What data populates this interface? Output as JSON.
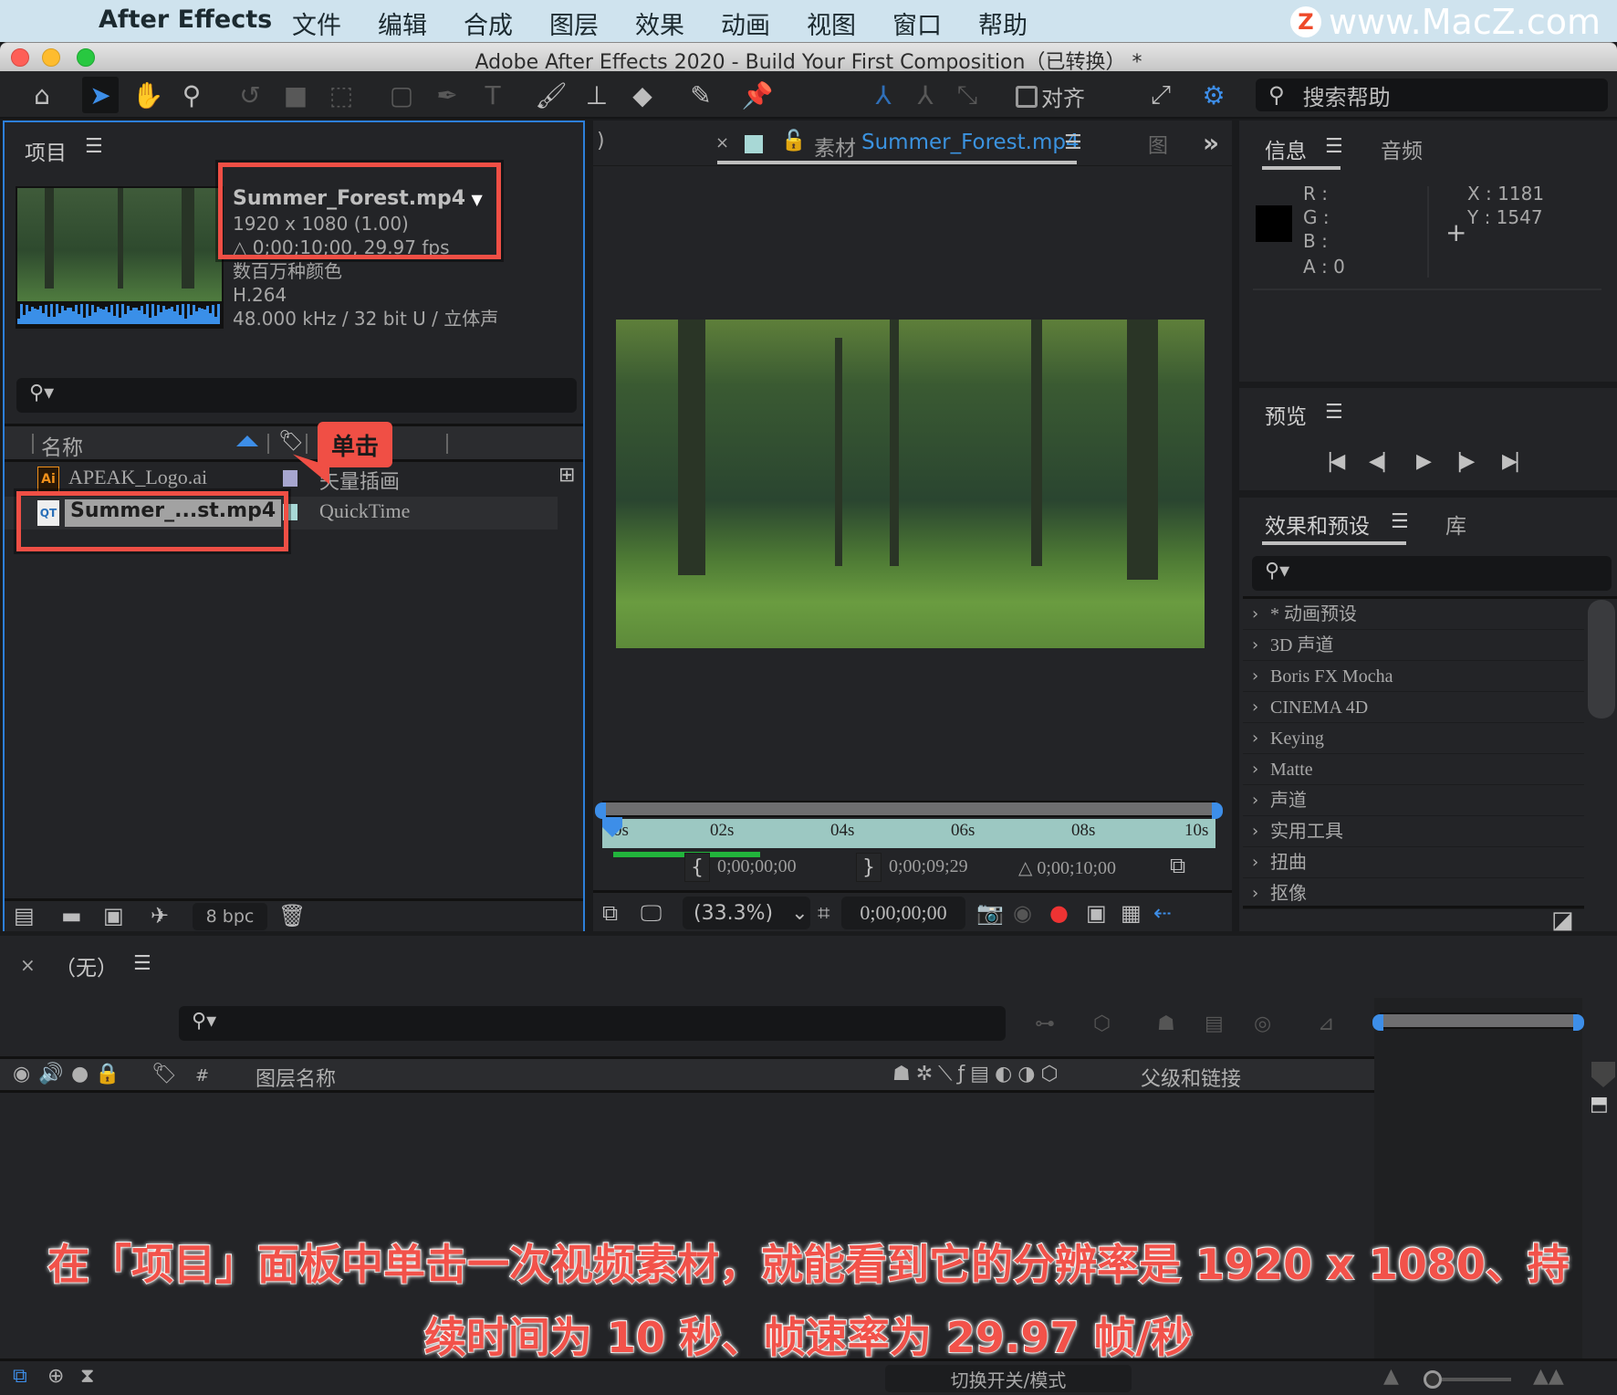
{
  "menubar": {
    "app_name": "After Effects",
    "items": [
      "文件",
      "编辑",
      "合成",
      "图层",
      "效果",
      "动画",
      "视图",
      "窗口",
      "帮助"
    ],
    "watermark": "www.MacZ.com",
    "watermark_logo": "Z"
  },
  "window": {
    "title": "Adobe After Effects 2020 - Build Your First Composition（已转换） *"
  },
  "toolbar": {
    "tools": [
      "home-icon",
      "selection-tool-icon",
      "hand-tool-icon",
      "zoom-tool-icon",
      "rotate-tool-icon",
      "camera-tool-icon",
      "pan-behind-tool-icon",
      "rectangle-tool-icon",
      "pen-tool-icon",
      "type-tool-icon",
      "brush-tool-icon",
      "clone-stamp-icon",
      "eraser-icon",
      "roto-brush-icon",
      "puppet-pin-icon"
    ],
    "snap_label": "对齐",
    "help_search_placeholder": "搜索帮助"
  },
  "project": {
    "title": "项目",
    "selected_item": {
      "name": "Summer_Forest.mp4",
      "dimensions": "1920 x 1080 (1.00)",
      "duration_fps": "△ 0;00;10;00, 29.97 fps",
      "colors": "数百万种颜色",
      "codec": "H.264",
      "audio": "48.000 kHz / 32 bit U / 立体声"
    },
    "search_placeholder": "",
    "columns": {
      "name": "名称",
      "type": ""
    },
    "items": [
      {
        "icon": "Ai",
        "name": "APEAK_Logo.ai",
        "label_color": "#a7a6cf",
        "type": "矢量插画",
        "selected": false
      },
      {
        "icon": "QT",
        "name": "Summer_...st.mp4",
        "label_color": "#a8d8d6",
        "type": "QuickTime",
        "selected": true
      }
    ],
    "callout": "单击",
    "bpc": "8 bpc"
  },
  "viewer": {
    "tab_prefix": "素材",
    "tab_name": "Summer_Forest.mp4",
    "tab_swatch_color": "#a8d8d6",
    "ruler_ticks": [
      "0s",
      "02s",
      "04s",
      "06s",
      "08s",
      "10s"
    ],
    "cache_fraction": 0.24,
    "in_point": "0;00;00;00",
    "out_point": "0;00;09;29",
    "duration": "△ 0;00;10;00",
    "magnification": "(33.3%)",
    "current_time": "0;00;00;00"
  },
  "info": {
    "tab_active": "信息",
    "tab_other": "音频",
    "r": "R :",
    "g": "G :",
    "b": "B :",
    "a": "A :  0",
    "x": "X : 1181",
    "y": "Y :  1547"
  },
  "preview": {
    "title": "预览"
  },
  "effects": {
    "tab_active": "效果和预设",
    "tab_other": "库",
    "items": [
      "* 动画预设",
      "3D 声道",
      "Boris FX Mocha",
      "CINEMA 4D",
      "Keying",
      "Matte",
      "声道",
      "实用工具",
      "扭曲",
      "抠像"
    ]
  },
  "timeline": {
    "title": "（无）",
    "col_hash": "#",
    "col_layer_name": "图层名称",
    "col_parent": "父级和链接",
    "switch_mode": "切换开关/模式"
  },
  "caption": {
    "line1": "在「项目」面板中单击一次视频素材，就能看到它的分辨率是 1920 x 1080、持",
    "line2": "续时间为 10 秒、帧速率为 29.97 帧/秒"
  }
}
